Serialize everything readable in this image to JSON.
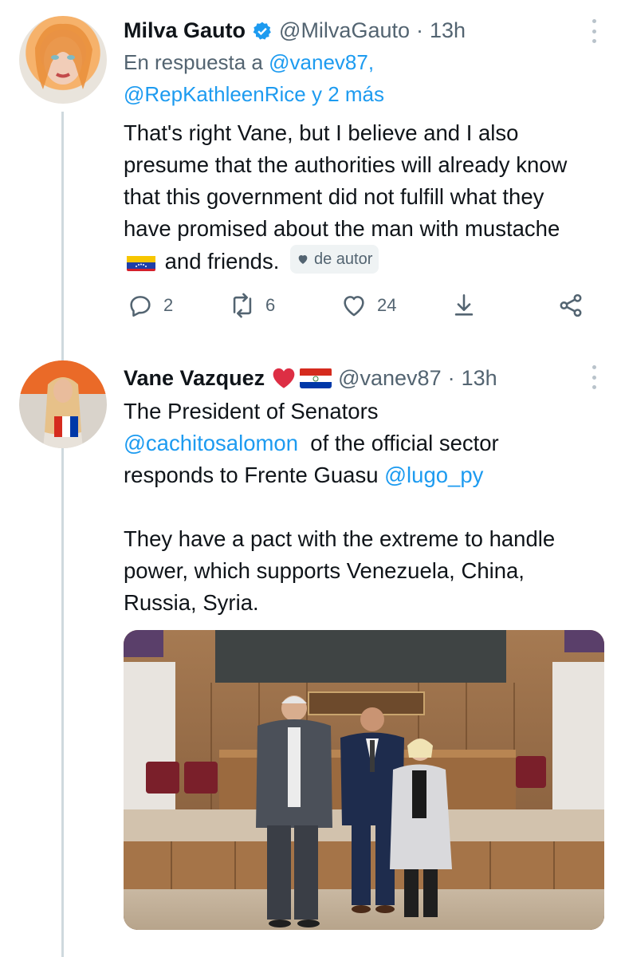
{
  "tweet1": {
    "display_name": "Milva Gauto",
    "handle": "@MilvaGauto",
    "separator": "·",
    "time": "13h",
    "reply_prefix": "En respuesta a",
    "reply_user1": "@vanev87,",
    "reply_user2": "@RepKathleenRice",
    "reply_more": "y 2 más",
    "body_part1": "That's right Vane, but I believe and I also presume that the authorities will already know that this government did not fulfill what they have promised about the man with mustache",
    "body_part2": "and friends.",
    "author_badge": "de autor",
    "replies": "2",
    "retweets": "6",
    "likes": "24"
  },
  "tweet2": {
    "display_name": "Vane Vazquez",
    "handle": "@vanev87",
    "separator": "·",
    "time": "13h",
    "line1": "The President of Senators",
    "mention1": "@cachitosalomon",
    "line2_rest": "of the official sector",
    "line3": "responds to Frente Guasu",
    "mention2": "@lugo_py",
    "para2": "They have a pact with the extreme to handle power, which supports Venezuela, China, Russia, Syria."
  },
  "colors": {
    "link": "#1d9bf0",
    "secondary_text": "#536471",
    "thread_line": "#cfd9de",
    "verified": "#1d9bf0"
  },
  "icons": [
    "verified-badge-icon",
    "more-options-icon",
    "reply-icon",
    "retweet-icon",
    "like-icon",
    "share-icon",
    "network-share-icon",
    "heart-emoji-icon",
    "paraguay-flag-icon",
    "venezuela-flag-icon"
  ]
}
